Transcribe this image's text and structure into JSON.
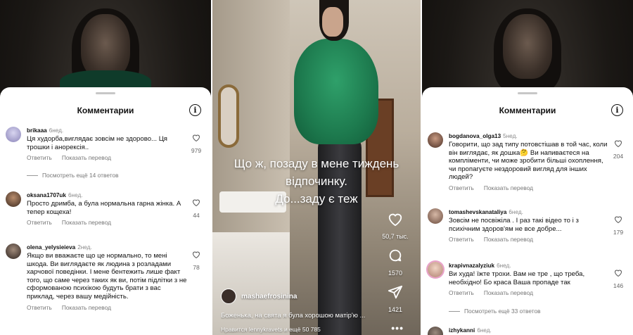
{
  "left_panel": {
    "sheet_title": "Комментарии",
    "comments": [
      {
        "username": "brikaaa",
        "time": "6нед.",
        "text": "Ця худорба,виглядає зовсім не здорово... Ця трошки і анорексія..",
        "reply": "Ответить",
        "translate": "Показать перевод",
        "likes": "979",
        "more_replies": "Посмотреть ещё 14 ответов"
      },
      {
        "username": "oksana1707uk",
        "time": "6нед.",
        "text": "Просто дримба, а була нормальна гарна жінка. А тепер кощеха!",
        "reply": "Ответить",
        "translate": "Показать перевод",
        "likes": "44"
      },
      {
        "username": "olena_yelysieieva",
        "time": "2нед.",
        "text": "Якщо ви вважаєте що це нормально, то мені шкода. Ви виглядаєте як людина з розладами харчової поведінки. І мене бентежить лише факт того, що саме через таких як ви, потім підлітки з не сформованою психікою будуть брати з вас приклад, через вашу медійність.",
        "reply": "Ответить",
        "translate": "Показать перевод",
        "likes": "78"
      }
    ]
  },
  "middle_panel": {
    "caption_lines": [
      "Що ж, позаду в мене тиждень",
      "відпочинку.",
      "До...заду є теж"
    ],
    "likes_count": "50,7 тыс.",
    "comments_count": "1570",
    "shares_count": "1421",
    "username": "mashaefrosinina",
    "post_caption": "Боженька, на свята я була хорошою матір'ю ...",
    "liked_by": "Нравится lennykravets и ещё 50 785"
  },
  "right_panel": {
    "sheet_title": "Комментарии",
    "comments": [
      {
        "username": "bogdanova_olga13",
        "time": "5нед.",
        "text": "Говорити, що зад типу потовстішав в той час, коли він виглядає, як дошка🤔 Ви напиваєтеся на компліменти, чи може зробити більші охоплення, чи пропагуєте нездоровий вигляд для інших людей?",
        "reply": "Ответить",
        "translate": "Показать перевод",
        "likes": "204"
      },
      {
        "username": "tomashevskanataliya",
        "time": "6нед.",
        "text": "Зовсім не посвіжіла . І раз такі відео то і з психічним здоров'ям не все добре...",
        "reply": "Ответить",
        "translate": "Показать перевод",
        "likes": "179"
      },
      {
        "username": "krapivnazalyziuk",
        "time": "6нед.",
        "text": "Ви худа! їжте трохи. Вам не тре , що треба, необхідно! Бо краса Ваша пропаде так",
        "reply": "Ответить",
        "translate": "Показать перевод",
        "likes": "146",
        "more_replies": "Посмотреть ещё 33 ответов"
      },
      {
        "username": "izhykanni",
        "time": "6нед."
      }
    ]
  },
  "colors": {
    "sweater_green": "#1d7a4e",
    "sheet_bg": "#ffffff",
    "muted_text": "#777777"
  }
}
